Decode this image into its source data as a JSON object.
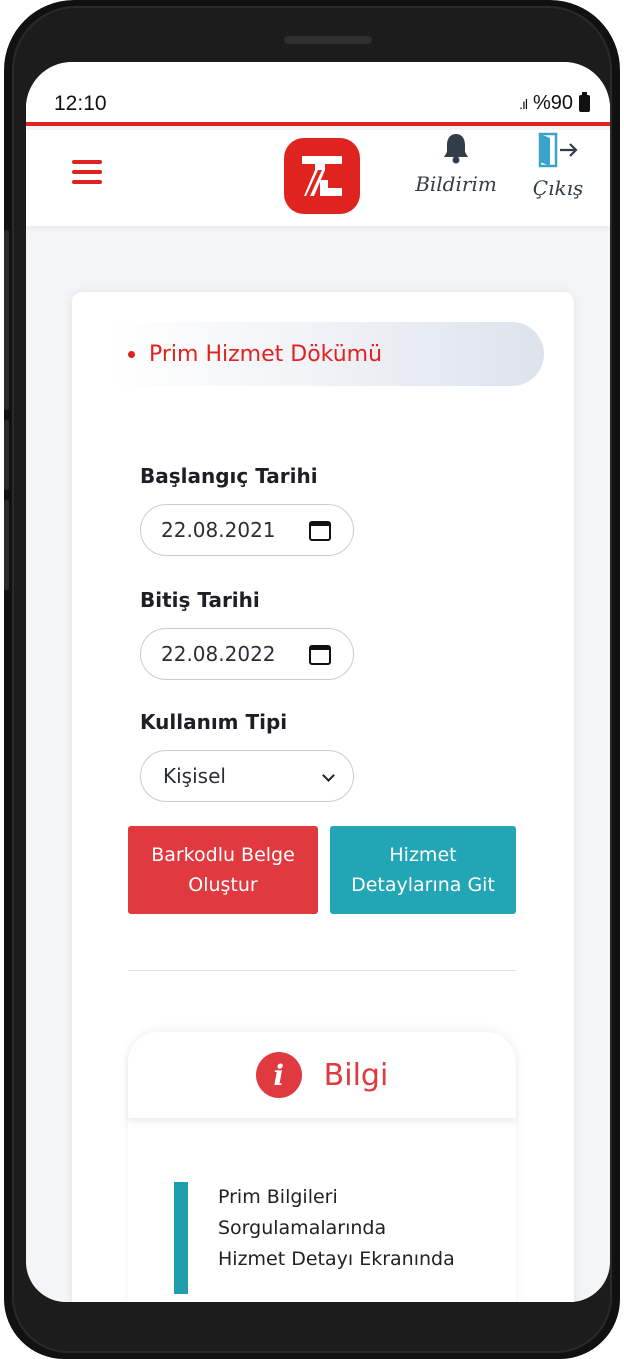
{
  "status_bar": {
    "time": "12:10",
    "signal": ".ıl",
    "battery": "%90"
  },
  "header": {
    "notifications_label": "Bildirim",
    "logout_label": "Çıkış",
    "accent_color": "#e0231f"
  },
  "page": {
    "title": "Prim Hizmet Dökümü"
  },
  "form": {
    "start_date_label": "Başlangıç Tarihi",
    "start_date_value": "22.08.2021",
    "end_date_label": "Bitiş Tarihi",
    "end_date_value": "22.08.2022",
    "usage_type_label": "Kullanım Tipi",
    "usage_type_value": "Kişisel"
  },
  "actions": {
    "barcode_line1": "Barkodlu Belge",
    "barcode_line2": "Oluştur",
    "details_line1": "Hizmet",
    "details_line2": "Detaylarına Git"
  },
  "info": {
    "icon_letter": "i",
    "title": "Bilgi",
    "line1": "Prim Bilgileri",
    "line2": "Sorgulamalarında",
    "line3": "Hizmet Detayı Ekranında"
  },
  "icons": [
    "hamburger-menu-icon",
    "app-logo",
    "bell-icon",
    "exit-door-icon",
    "calendar-icon",
    "chevron-down-icon",
    "info-icon"
  ]
}
